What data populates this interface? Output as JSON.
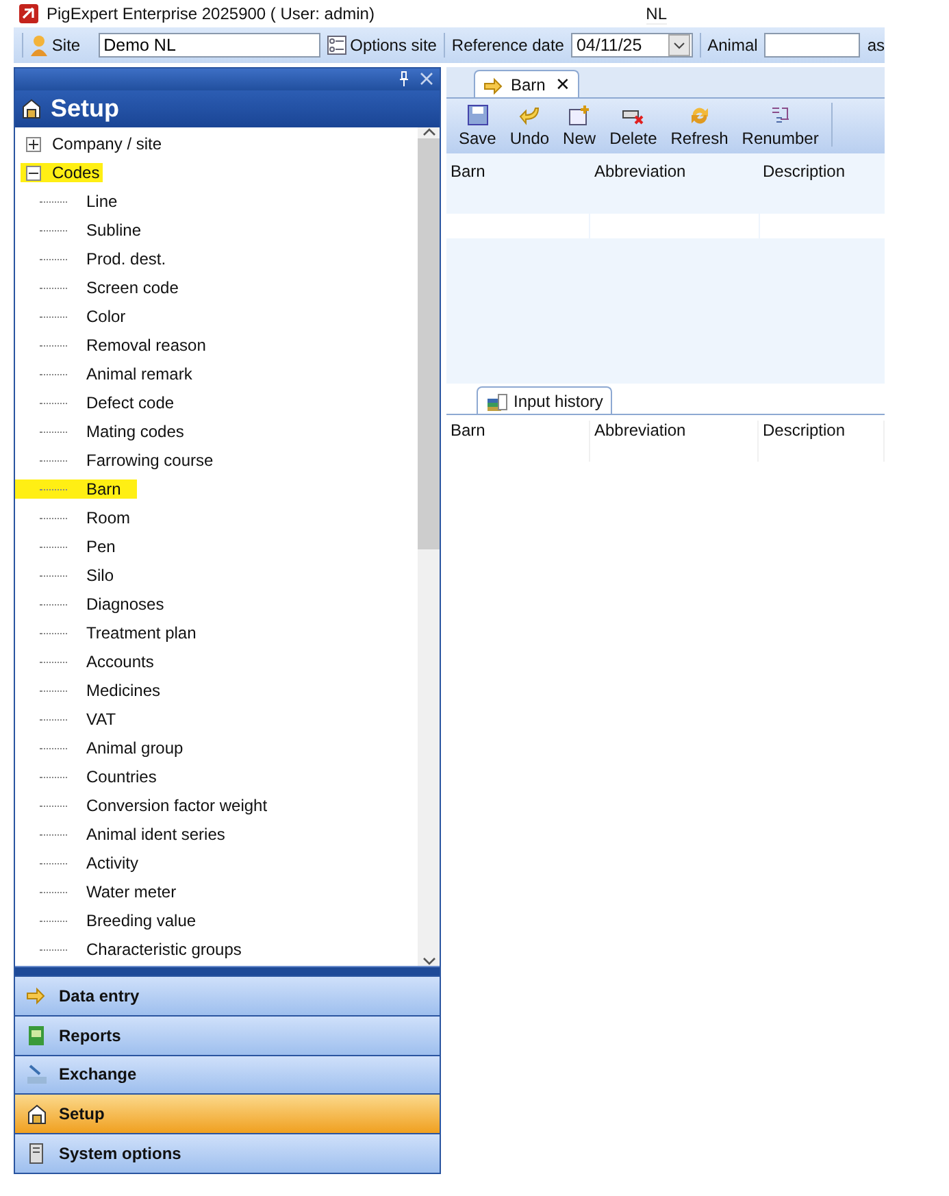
{
  "window": {
    "title": "PigExpert Enterprise  2025900  ( User: admin)",
    "language": "NL"
  },
  "toolbar": {
    "site_label": "Site",
    "site_value": "Demo NL",
    "options_label": "Options site",
    "date_label": "Reference date",
    "date_value": "04/11/25",
    "animal_label": "Animal",
    "trailing": "as"
  },
  "sidebar": {
    "title": "Setup",
    "tree": [
      {
        "label": "Company / site",
        "expanded": false,
        "highlighted": false
      },
      {
        "label": "Codes",
        "expanded": true,
        "highlighted": true,
        "children": [
          {
            "label": "Line",
            "highlighted": false
          },
          {
            "label": "Subline",
            "highlighted": false
          },
          {
            "label": "Prod. dest.",
            "highlighted": false
          },
          {
            "label": "Screen code",
            "highlighted": false
          },
          {
            "label": "Color",
            "highlighted": false
          },
          {
            "label": "Removal reason",
            "highlighted": false
          },
          {
            "label": "Animal remark",
            "highlighted": false
          },
          {
            "label": "Defect code",
            "highlighted": false
          },
          {
            "label": "Mating codes",
            "highlighted": false
          },
          {
            "label": "Farrowing course",
            "highlighted": false
          },
          {
            "label": "Barn",
            "highlighted": true
          },
          {
            "label": "Room",
            "highlighted": false
          },
          {
            "label": "Pen",
            "highlighted": false
          },
          {
            "label": "Silo",
            "highlighted": false
          },
          {
            "label": "Diagnoses",
            "highlighted": false
          },
          {
            "label": "Treatment plan",
            "highlighted": false
          },
          {
            "label": "Accounts",
            "highlighted": false
          },
          {
            "label": "Medicines",
            "highlighted": false
          },
          {
            "label": "VAT",
            "highlighted": false
          },
          {
            "label": "Animal group",
            "highlighted": false
          },
          {
            "label": "Countries",
            "highlighted": false
          },
          {
            "label": "Conversion factor weight",
            "highlighted": false
          },
          {
            "label": "Animal ident series",
            "highlighted": false
          },
          {
            "label": "Activity",
            "highlighted": false
          },
          {
            "label": "Water meter",
            "highlighted": false
          },
          {
            "label": "Breeding value",
            "highlighted": false
          },
          {
            "label": "Characteristic groups",
            "highlighted": false
          }
        ]
      }
    ],
    "nav": [
      {
        "label": "Data entry",
        "kind": "entry",
        "selected": false
      },
      {
        "label": "Reports",
        "kind": "reports",
        "selected": false
      },
      {
        "label": "Exchange",
        "kind": "exchange",
        "selected": false
      },
      {
        "label": "Setup",
        "kind": "setup",
        "selected": true
      },
      {
        "label": "System options",
        "kind": "system",
        "selected": false
      }
    ]
  },
  "document_tab": {
    "label": "Barn",
    "close": "✕"
  },
  "actions": [
    {
      "label": "Save",
      "kind": "save"
    },
    {
      "label": "Undo",
      "kind": "undo"
    },
    {
      "label": "New",
      "kind": "new"
    },
    {
      "label": "Delete",
      "kind": "delete"
    },
    {
      "label": "Refresh",
      "kind": "refresh"
    },
    {
      "label": "Renumber",
      "kind": "renumber"
    }
  ],
  "table": {
    "columns": [
      "Barn",
      "Abbreviation",
      "Description"
    ]
  },
  "history_tab": {
    "label": "Input history"
  },
  "history_table": {
    "columns": [
      "Barn",
      "Abbreviation",
      "Description"
    ]
  }
}
